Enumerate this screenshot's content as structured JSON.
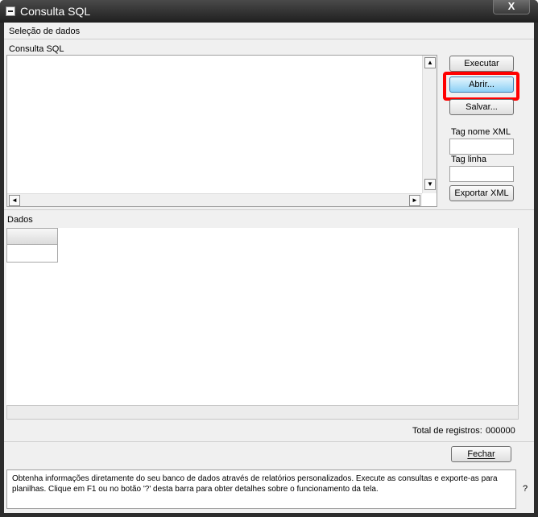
{
  "window": {
    "title": "Consulta SQL",
    "close_label": "X"
  },
  "section_selecao": "Seleção de dados",
  "section_consulta": "Consulta SQL",
  "editor": {
    "value": "",
    "scroll_up": "▲",
    "scroll_down": "▼",
    "scroll_left": "◄",
    "scroll_right": "►"
  },
  "buttons": {
    "executar": "Executar",
    "abrir": "Abrir...",
    "salvar": "Salvar...",
    "exportar_xml": "Exportar XML",
    "fechar": "Fechar"
  },
  "fields": {
    "tag_nome_xml_label": "Tag nome XML",
    "tag_nome_xml_value": "",
    "tag_linha_label": "Tag linha",
    "tag_linha_value": ""
  },
  "section_dados": "Dados",
  "totals": {
    "label": "Total de registros:",
    "value": "000000"
  },
  "help": {
    "text": "Obtenha informações diretamente do seu banco de dados através de relatórios personalizados. Execute as consultas e exporte-as para planilhas. Clique em F1 ou no botão '?' desta barra para obter detalhes sobre o funcionamento da tela.",
    "button": "?"
  },
  "colors": {
    "highlight": "#ff0000",
    "focused_button": "#8cd0f5",
    "titlebar": "#2c2c2c"
  }
}
